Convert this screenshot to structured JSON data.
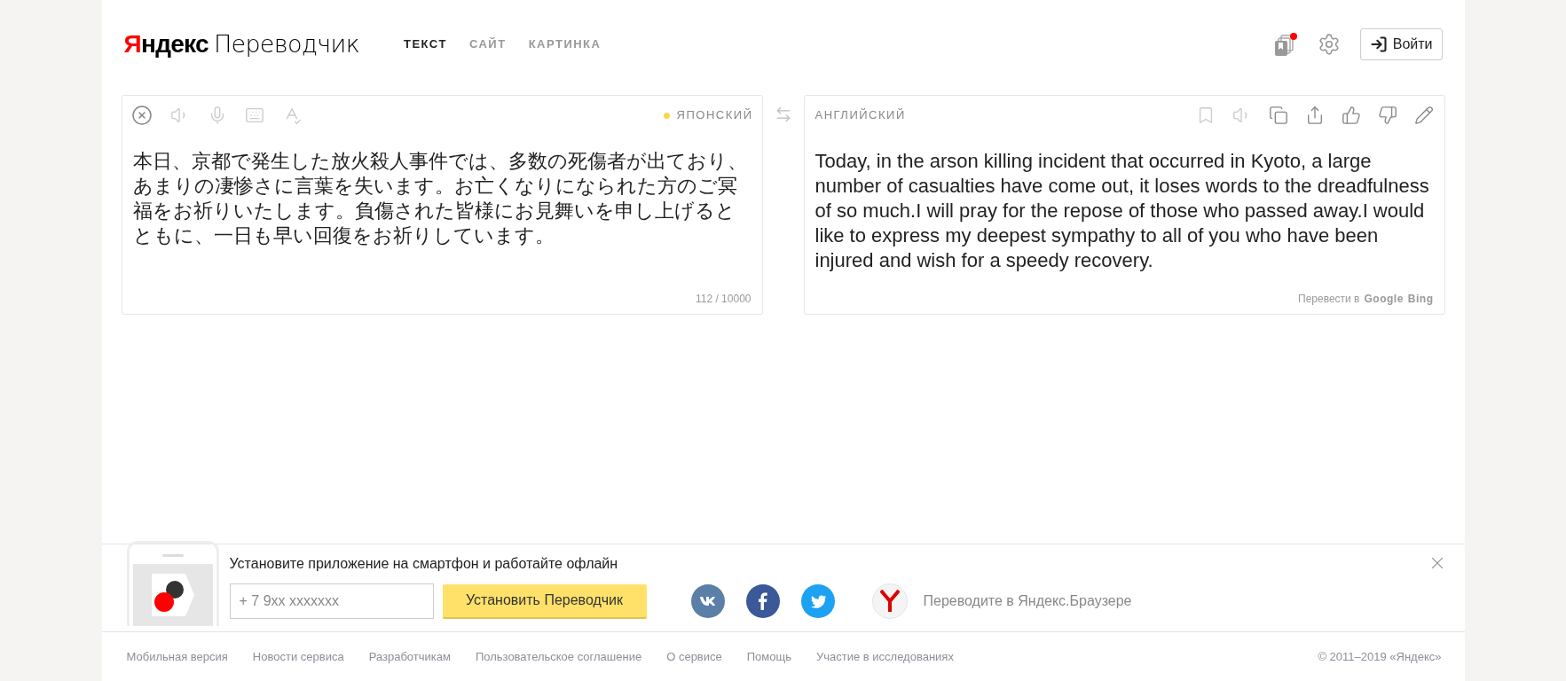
{
  "logo": {
    "brand_initial": "Я",
    "brand_rest": "ндекс",
    "product": "Переводчик"
  },
  "tabs": [
    {
      "label": "ТЕКСТ",
      "selected": true
    },
    {
      "label": "САЙТ",
      "selected": false
    },
    {
      "label": "КАРТИНКА",
      "selected": false
    }
  ],
  "header": {
    "notification": true,
    "login_button": "Войти"
  },
  "source": {
    "language": "ЯПОНСКИЙ",
    "text": "本日、京都で発生した放火殺人事件では、多数の死傷者が出ており、あまりの凄惨さに言葉を失います。お亡くなりになられた方のご冥福をお祈りいたします。負傷された皆様にお見舞いを申し上げるとともに、一日も早い回復をお祈りしています。",
    "counter": "112 / 10000"
  },
  "target": {
    "language": "АНГЛИЙСКИЙ",
    "text": "Today, in the arson killing incident that occurred in Kyoto, a large number of casualties have come out, it loses words to the dreadfulness of so much.I will pray for the repose of those who passed away.I would like to express my deepest sympathy to all of you who have been injured and wish for a speedy recovery.",
    "translate_in": "Перевести в",
    "engines": [
      "Google",
      "Bing"
    ]
  },
  "app_banner": {
    "title": "Установите приложение на смартфон и работайте офлайн",
    "phone_placeholder": "+ 7 9xx xxxxxxx",
    "install_button": "Установить Переводчик",
    "browser_link": "Переводите в Яндекс.Браузере"
  },
  "footer": {
    "links": [
      "Мобильная версия",
      "Новости сервиса",
      "Разработчикам",
      "Пользовательское соглашение",
      "О сервисе",
      "Помощь",
      "Участие в исследованиях"
    ],
    "copyright": "© 2011–2019 «Яндекс»"
  }
}
